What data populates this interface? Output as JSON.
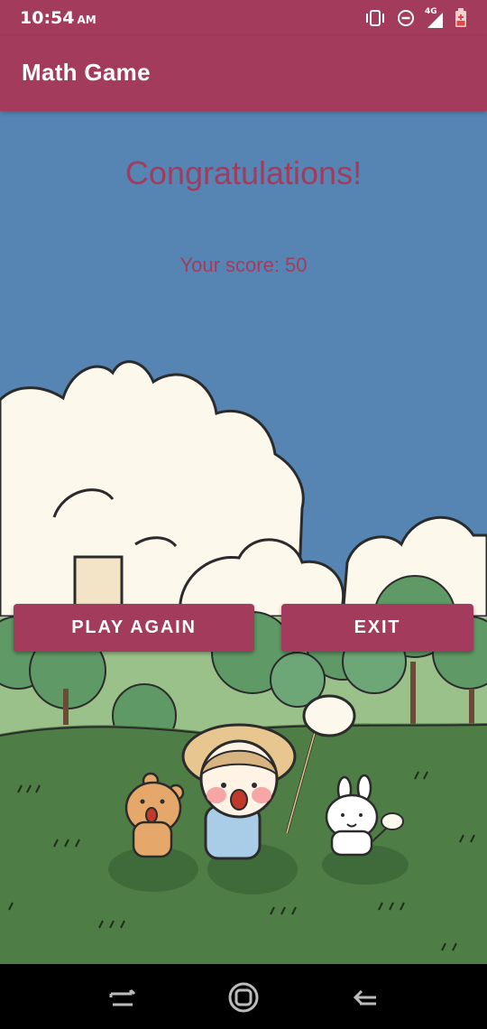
{
  "status_bar": {
    "time": "10:54",
    "ampm": "AM",
    "network_label": "4G",
    "icons": [
      "vibrate-icon",
      "do-not-disturb-icon",
      "signal-icon",
      "battery-icon"
    ]
  },
  "app_bar": {
    "title": "Math Game"
  },
  "result": {
    "heading": "Congratulations!",
    "score_text": "Your score: 50"
  },
  "buttons": {
    "play_again": "PLAY AGAIN",
    "exit": "EXIT"
  },
  "nav_bar": {
    "icons": [
      "recents-icon",
      "home-icon",
      "back-icon"
    ]
  },
  "colors": {
    "primary": "#a33b5d",
    "sky": "#5685b4",
    "grass": "#4e7d45",
    "cloud": "#fdf8ec"
  }
}
